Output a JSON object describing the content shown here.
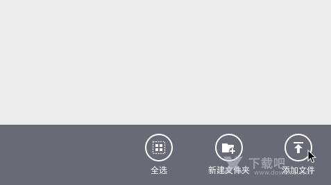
{
  "app_bar": {
    "commands": [
      {
        "label": "全选",
        "icon": "select-all-icon"
      },
      {
        "label": "新建文件夹",
        "icon": "new-folder-icon"
      },
      {
        "label": "添加文件",
        "icon": "upload-icon"
      }
    ]
  },
  "watermark": {
    "text": "下载吧",
    "url": "www.downxia.com"
  },
  "colors": {
    "content_bg": "#ececec",
    "app_bar_bg": "#686b75",
    "icon_stroke": "#ffffff"
  }
}
